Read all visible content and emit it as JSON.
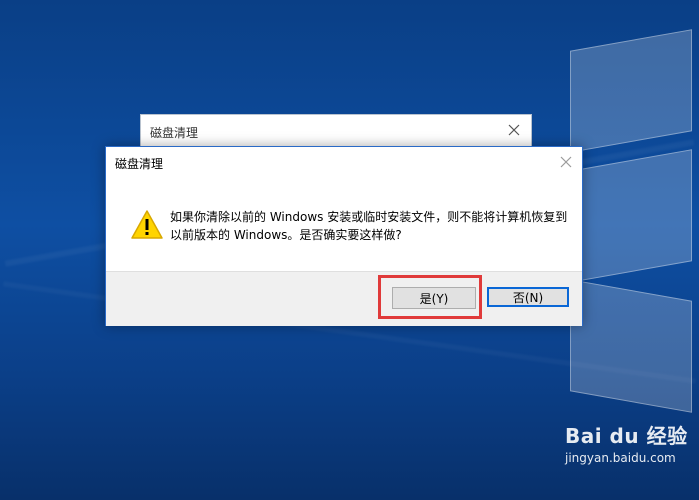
{
  "background_window": {
    "title": "磁盘清理"
  },
  "dialog": {
    "title": "磁盘清理",
    "message": "如果你清除以前的 Windows 安装或临时安装文件，则不能将计算机恢复到以前版本的 Windows。是否确实要这样做?",
    "buttons": {
      "yes": "是(Y)",
      "no": "否(N)"
    },
    "icon": "warning-icon"
  },
  "watermark": {
    "top": "Bai du 经验",
    "bottom": "jingyan.baidu.com"
  },
  "colors": {
    "desktop_blue": "#0e4fa3",
    "dialog_border": "#2a6ac7",
    "highlight_red": "#e03a3a",
    "default_button_border": "#0a67d6",
    "warning_yellow": "#ffd400"
  }
}
